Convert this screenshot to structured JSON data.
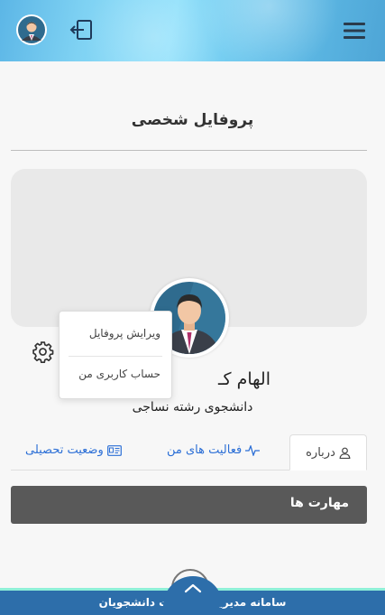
{
  "header": {
    "avatar_icon": "user-avatar-icon",
    "logout_icon": "logout-icon",
    "menu_icon": "hamburger-menu-icon"
  },
  "page": {
    "title": "پروفایل شخصی"
  },
  "profile": {
    "name": "الهام کـ",
    "subtitle": "دانشجوی رشته نساجی"
  },
  "settings_menu": {
    "icon": "gear-icon",
    "items": [
      {
        "label": "ویرایش پروفایل"
      },
      {
        "label": "حساب کاربری من"
      }
    ]
  },
  "tabs": [
    {
      "label": "درباره",
      "icon": "user-icon",
      "active": true
    },
    {
      "label": "فعالیت های من",
      "icon": "activity-icon",
      "active": false
    },
    {
      "label": "وضعیت تحصیلی",
      "icon": "id-card-icon",
      "active": false
    }
  ],
  "sections": {
    "skills_title": "مهارت ها"
  },
  "footer": {
    "title": "سامانه مدیریت اطلاعات دانشجویان",
    "scroll_icon": "chevron-up-icon"
  },
  "colors": {
    "link": "#2c6fd6",
    "footer": "#2d6eaa",
    "skills_bar": "#595959"
  }
}
